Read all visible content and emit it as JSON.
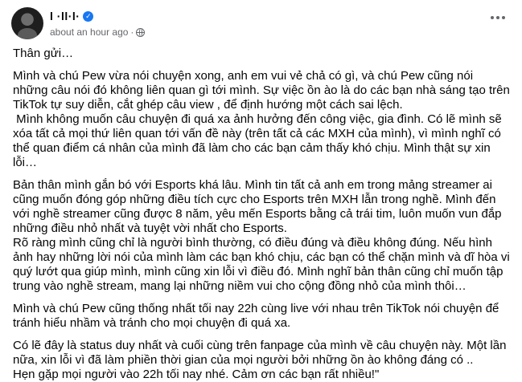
{
  "header": {
    "author_name": "l     ·ll·l·",
    "timestamp": "about an hour ago",
    "separator": "·",
    "verified_badge": "✓",
    "privacy_icon": "globe-icon",
    "more_icon": "more-options-icon"
  },
  "post": {
    "paragraphs": [
      "Thân gửi…",
      "Mình và chú Pew vừa nói chuyện xong, anh em vui vẻ chả có gì, và chú Pew cũng nói những câu nói đó không liên quan gì tới mình. Sự việc ồn ào là do các bạn nhà sáng tạo trên TikTok tự suy diễn, cắt ghép câu view , để định hướng một cách sai lệch.\n Mình không muốn câu chuyện đi quá xa ảnh hưởng đến công việc, gia đình. Có lẽ mình sẽ xóa tất cả mọi thứ liên quan tới vấn đề này (trên tất cả các MXH của mình), vì mình nghĩ có thể quan điểm cá nhân của mình đã làm cho các bạn cảm thấy khó chịu. Mình thật sự xin lỗi…",
      "Bản thân mình gắn bó với Esports khá lâu. Mình tin tất cả anh em trong mảng streamer ai cũng muốn đóng góp những điều tích cực cho Esports trên MXH lẫn trong nghề. Mình đến với nghề streamer cũng được 8 năm, yêu mến Esports bằng cả trái tim, luôn muốn vun đắp những điều nhỏ nhất và tuyệt vời nhất cho Esports.\nRõ ràng mình cũng chỉ là người bình thường, có điều đúng và điều không đúng. Nếu hình ảnh hay những lời nói của mình làm các bạn khó chịu, các bạn có thể chặn mình và dĩ hòa vi quý lướt qua giúp mình, mình cũng xin lỗi vì điều đó. Mình nghĩ bản thân cũng chỉ muốn tập trung vào nghề stream, mang lại những niềm vui cho cộng đồng nhỏ của mình thôi…",
      "Mình và chú Pew cũng thống nhất tối nay 22h cùng live với nhau trên TikTok nói chuyện để tránh hiểu nhầm và tránh cho mọi chuyện đi quá xa.",
      "Có lẽ đây là status duy nhất và cuối cùng trên fanpage của mình về câu chuyện này. Một lần nữa, xin lỗi vì đã làm phiền thời gian của mọi người bởi những ồn ào không đáng có ..\nHẹn gặp mọi người vào 22h tối nay nhé. Cảm ơn các bạn rất nhiều!\""
    ]
  }
}
